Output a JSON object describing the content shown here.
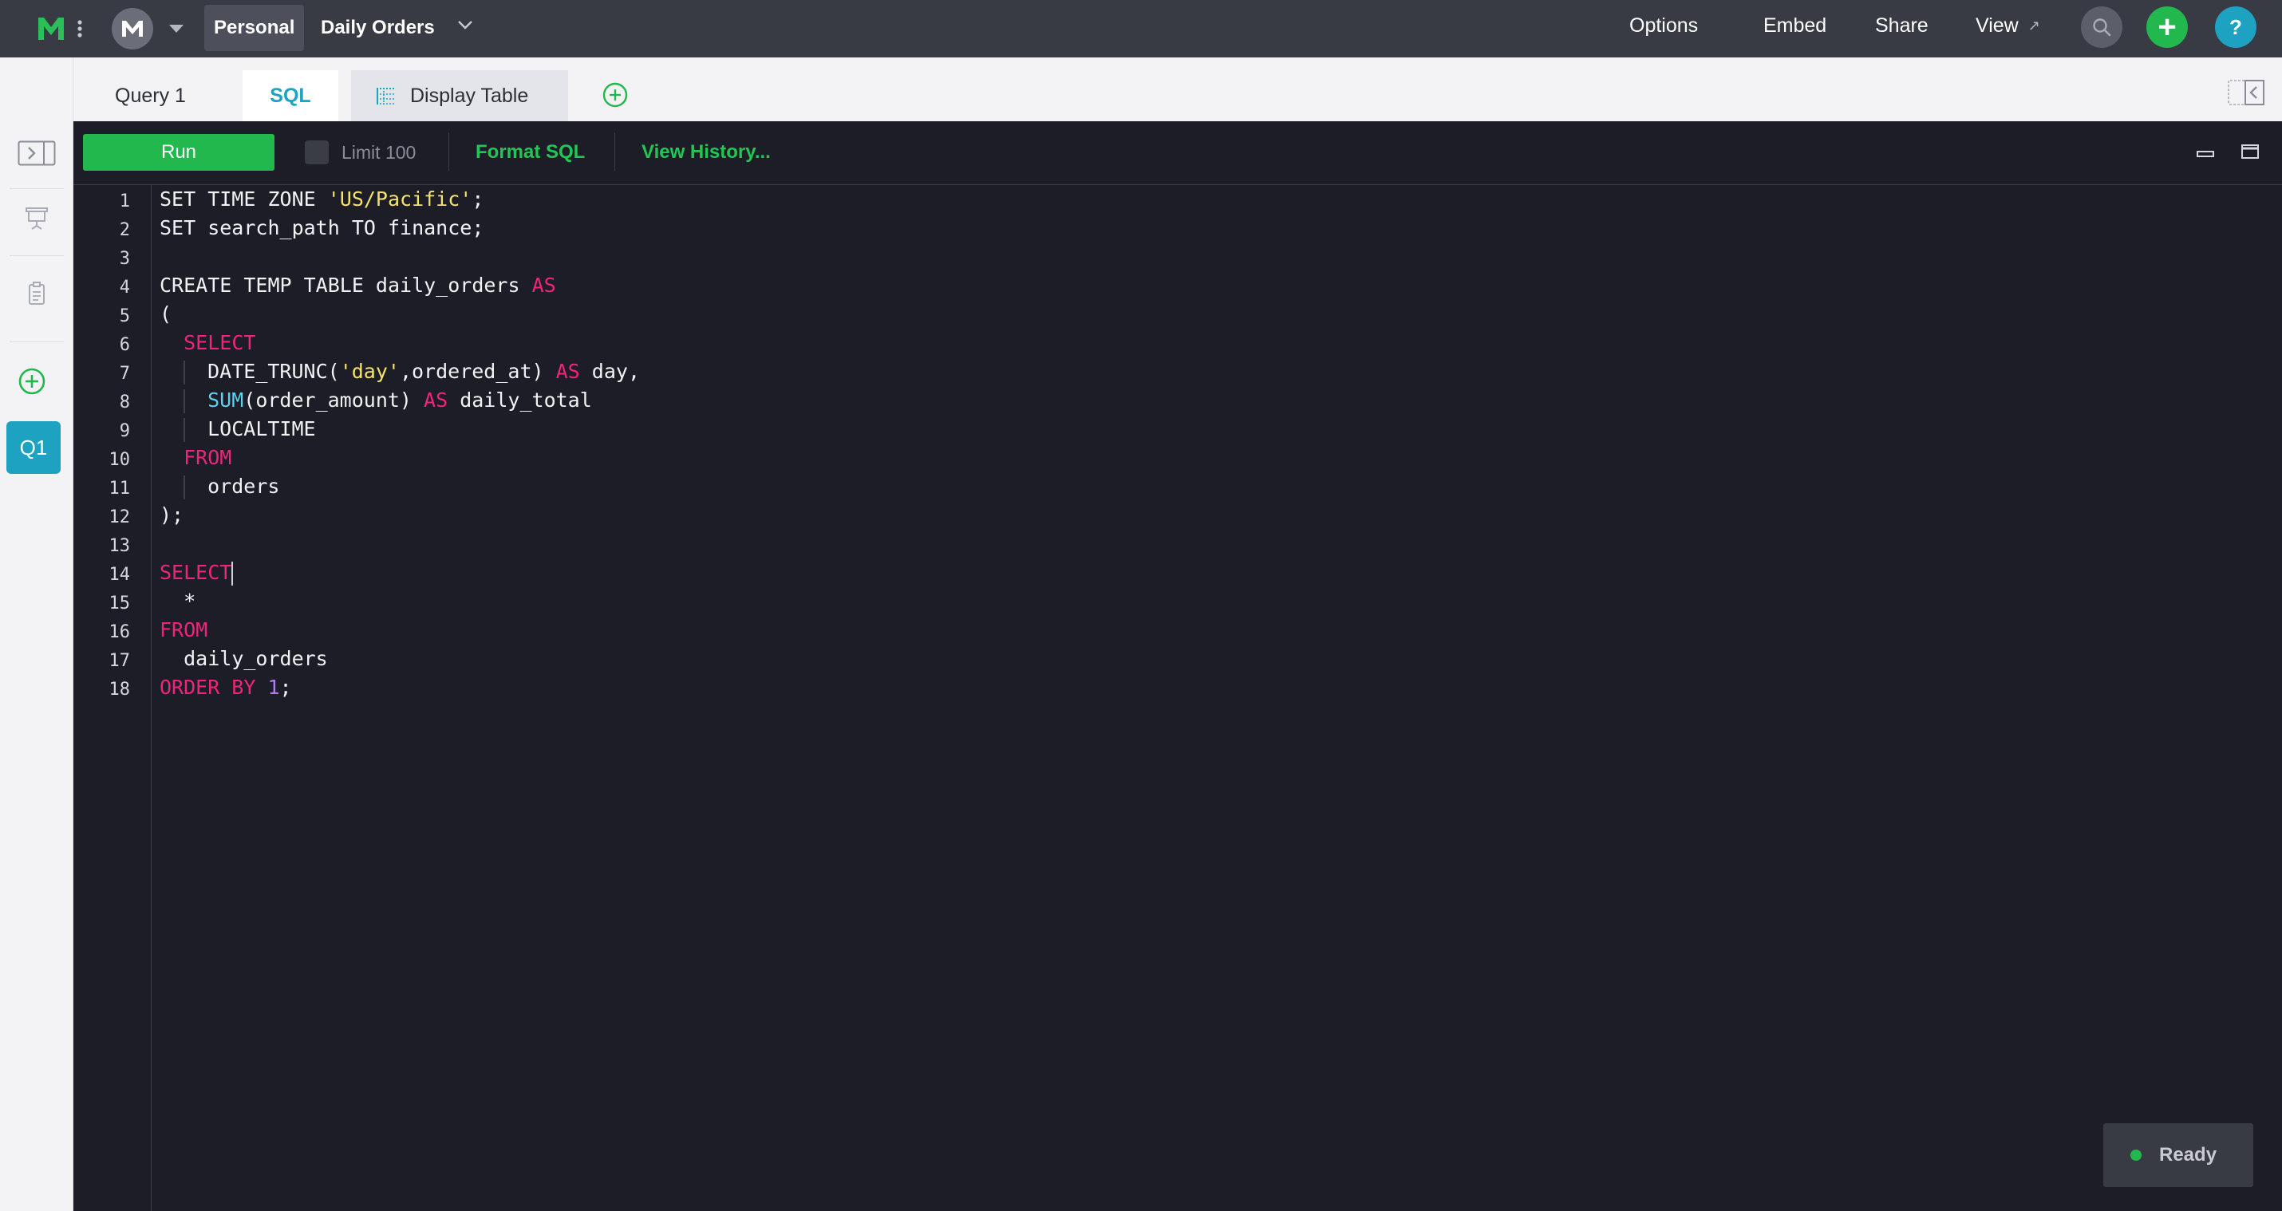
{
  "topbar": {
    "breadcrumb": {
      "workspace": "Personal",
      "report": "Daily Orders"
    },
    "links": {
      "options": "Options",
      "embed": "Embed",
      "share": "Share",
      "view": "View"
    },
    "view_arrow": "↗",
    "help": "?",
    "add": "+"
  },
  "rail": {
    "query_badge": "Q1"
  },
  "tabs": {
    "query": "Query 1",
    "sql": "SQL",
    "display_table": "Display Table"
  },
  "toolbar": {
    "run": "Run",
    "limit": "Limit 100",
    "format_sql": "Format SQL",
    "view_history": "View History..."
  },
  "editor": {
    "line_numbers": [
      "1",
      "2",
      "3",
      "4",
      "5",
      "6",
      "7",
      "8",
      "9",
      "10",
      "11",
      "12",
      "13",
      "14",
      "15",
      "16",
      "17",
      "18"
    ]
  },
  "status": {
    "text": "Ready"
  },
  "colors": {
    "accent_green": "#22b84d",
    "accent_teal": "#1ea2c2",
    "keyword": "#f0247a",
    "string": "#f6e36b",
    "function": "#5fd0ee",
    "number": "#b07cf0"
  }
}
